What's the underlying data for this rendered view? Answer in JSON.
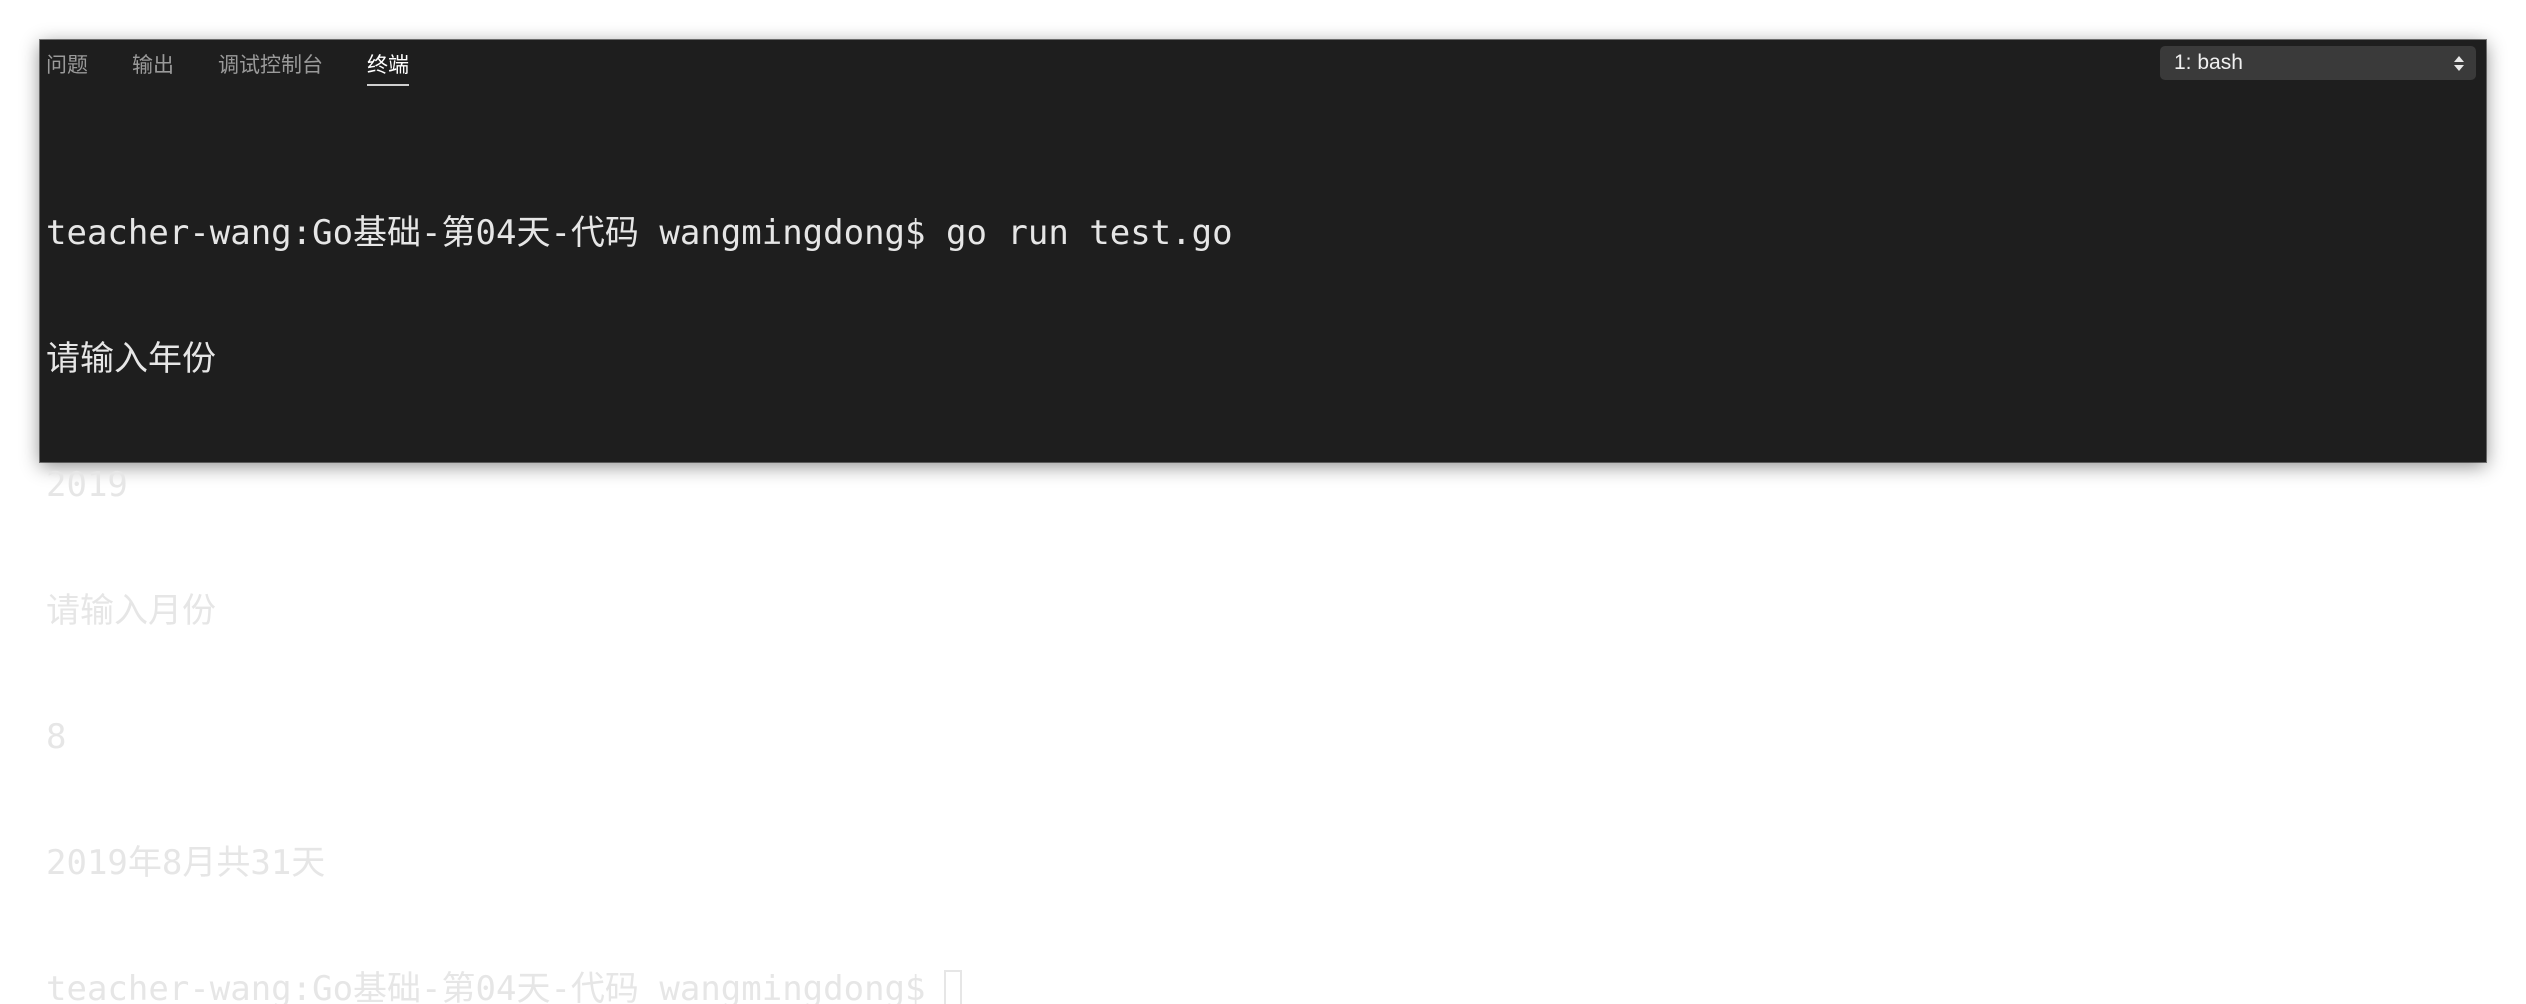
{
  "panel": {
    "tabs": [
      {
        "label": "问题"
      },
      {
        "label": "输出"
      },
      {
        "label": "调试控制台"
      },
      {
        "label": "终端"
      }
    ],
    "active_tab": "终端",
    "terminal_selector": {
      "value": "1: bash"
    }
  },
  "terminal": {
    "lines": [
      "teacher-wang:Go基础-第04天-代码 wangmingdong$ go run test.go",
      "请输入年份",
      "2019",
      "请输入月份",
      "8",
      "2019年8月共31天",
      "teacher-wang:Go基础-第04天-代码 wangmingdong$"
    ]
  },
  "colors": {
    "background": "#1e1e1e",
    "text": "#e6e6e6",
    "tab_inactive": "#9a9a9a",
    "tab_active": "#ffffff",
    "select_background": "#3a3a3a"
  }
}
